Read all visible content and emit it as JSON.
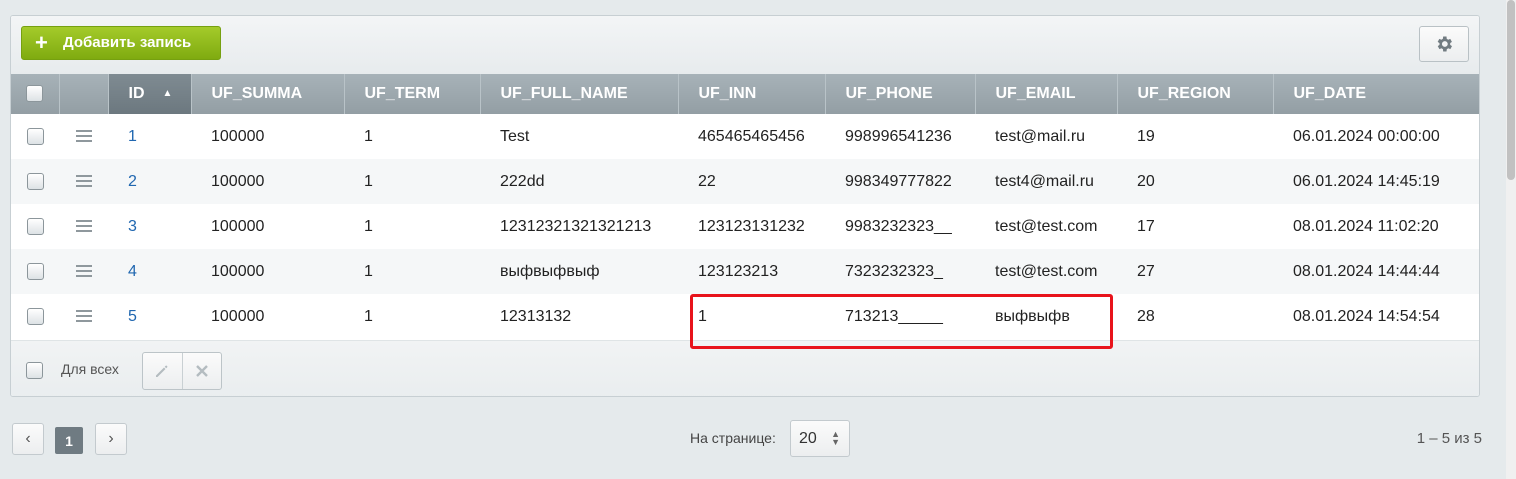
{
  "toolbar": {
    "add_label": "Добавить запись",
    "add_icon": "plus-icon",
    "settings_icon": "gear-icon"
  },
  "grid": {
    "columns": [
      "",
      "",
      "ID",
      "UF_SUMMA",
      "UF_TERM",
      "UF_FULL_NAME",
      "UF_INN",
      "UF_PHONE",
      "UF_EMAIL",
      "UF_REGION",
      "UF_DATE"
    ],
    "sort": {
      "column": "ID",
      "direction": "ascending",
      "indicator": "▲"
    },
    "rows": [
      [
        "1",
        "100000",
        "1",
        "Test",
        "465465465456",
        "998996541236",
        "test@mail.ru",
        "19",
        "06.01.2024 00:00:00"
      ],
      [
        "2",
        "100000",
        "1",
        "222dd",
        "22",
        "998349777822",
        "test4@mail.ru",
        "20",
        "06.01.2024 14:45:19"
      ],
      [
        "3",
        "100000",
        "1",
        "12312321321321213",
        "123123131232",
        "9983232323__",
        "test@test.com",
        "17",
        "08.01.2024 11:02:20"
      ],
      [
        "4",
        "100000",
        "1",
        "выфвыфвыф",
        "123123213",
        "7323232323_",
        "test@test.com",
        "27",
        "08.01.2024 14:44:44"
      ],
      [
        "5",
        "100000",
        "1",
        "12313132",
        "1",
        "713213_____",
        "выфвыфв",
        "28",
        "08.01.2024 14:54:54"
      ]
    ]
  },
  "footer": {
    "for_all_label": "Для всех",
    "edit_icon": "pencil-icon",
    "delete_icon": "close-icon"
  },
  "pagination": {
    "prev": "‹",
    "current_page": "1",
    "next": "›",
    "per_page_label": "На странице:",
    "per_page_value": "20",
    "range_text": "1 – 5 из 5"
  },
  "colors": {
    "accent": "#8bb81b",
    "header": "#9aa5ab",
    "link": "#2067b0",
    "highlight": "#e8131b"
  }
}
